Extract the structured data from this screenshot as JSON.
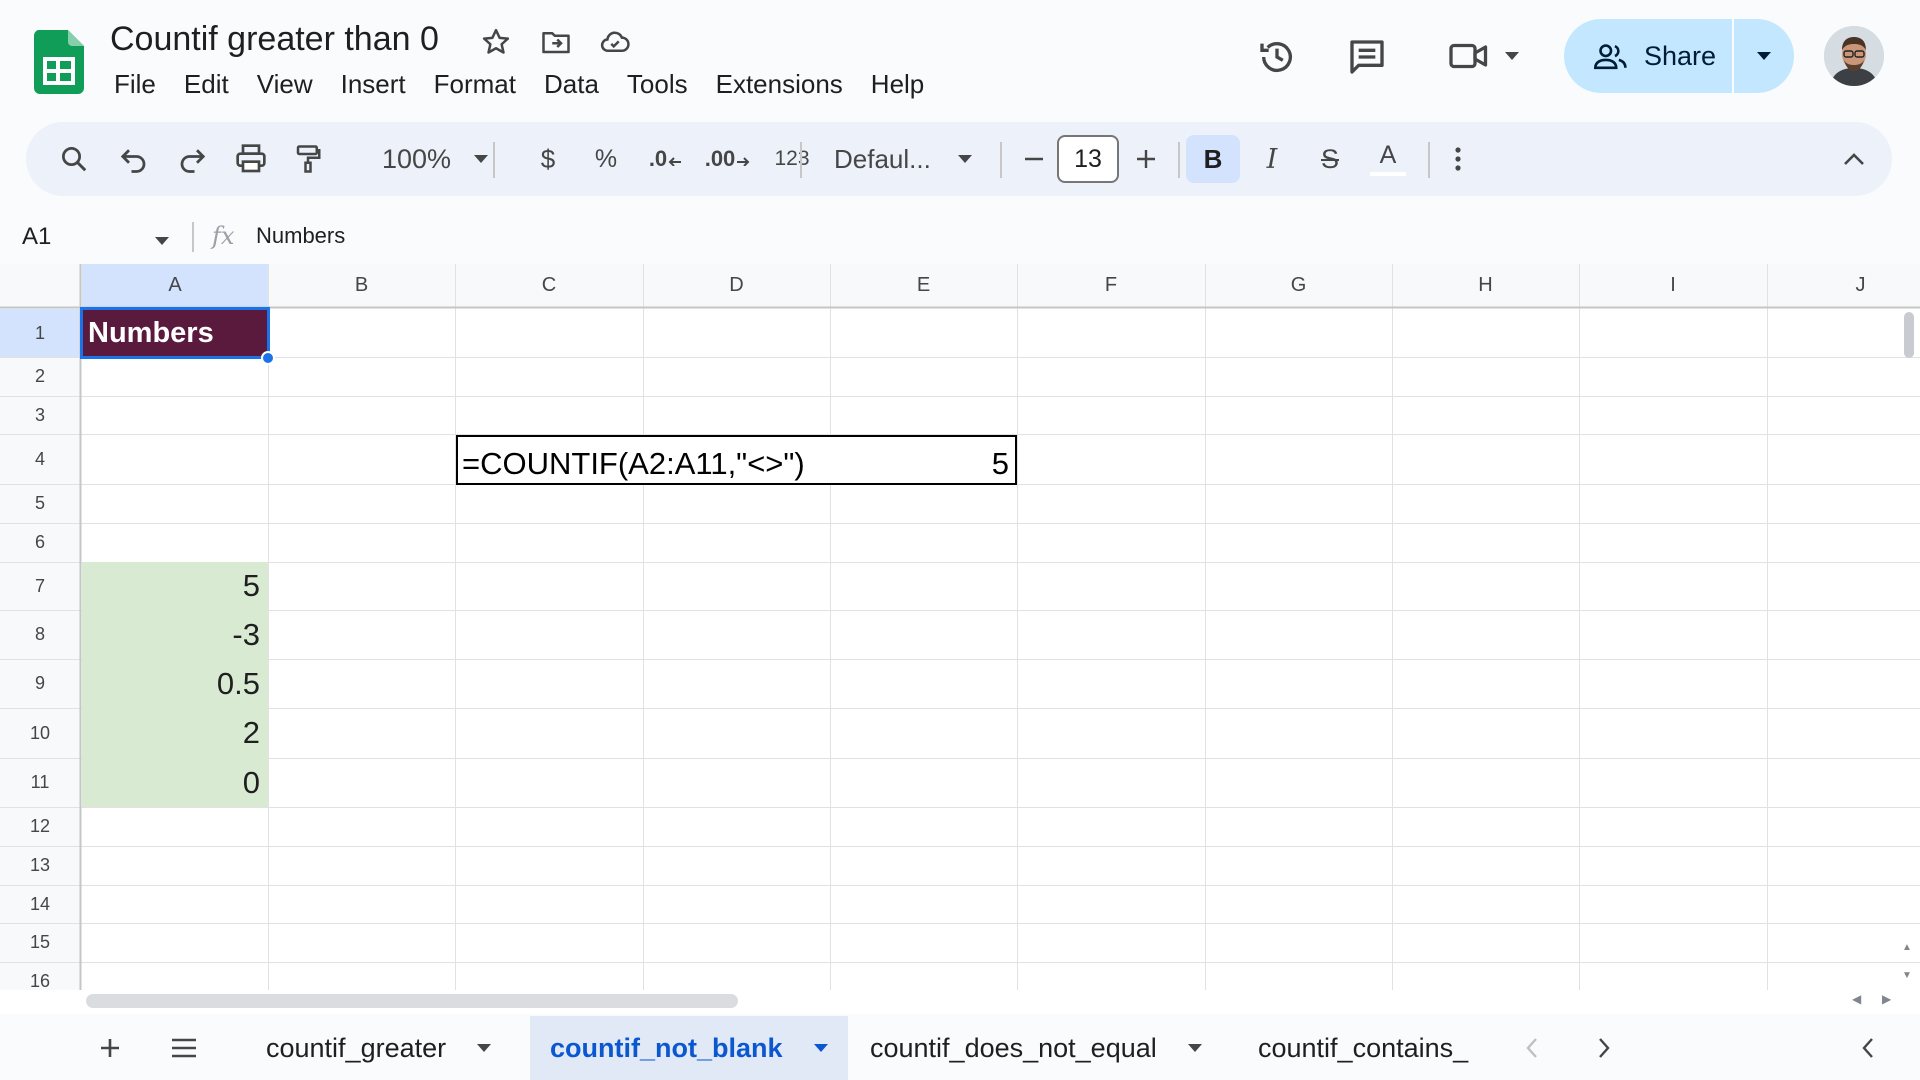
{
  "document": {
    "title": "Countif greater than 0"
  },
  "menu": {
    "items": [
      "File",
      "Edit",
      "View",
      "Insert",
      "Format",
      "Data",
      "Tools",
      "Extensions",
      "Help"
    ]
  },
  "header": {
    "share_label": "Share"
  },
  "toolbar": {
    "zoom": "100%",
    "currency_symbol": "$",
    "percent_symbol": "%",
    "decrease_decimal": ".0",
    "increase_decimal": ".00",
    "number_format": "123",
    "font_family": "Defaul...",
    "font_size": "13",
    "bold_label": "B",
    "italic_label": "I",
    "strike_label": "S",
    "text_color_label": "A"
  },
  "formula_bar": {
    "cell_ref": "A1",
    "fx_label": "fx",
    "content": "Numbers"
  },
  "grid": {
    "columns": [
      "A",
      "B",
      "C",
      "D",
      "E",
      "F",
      "G",
      "H",
      "I",
      "J"
    ],
    "rows": [
      "1",
      "2",
      "3",
      "4",
      "5",
      "6",
      "7",
      "8",
      "9",
      "10",
      "11",
      "12",
      "13",
      "14",
      "15",
      "16"
    ],
    "header_cell": "Numbers",
    "values": [
      "5",
      "-3",
      "0.5",
      "2",
      "0"
    ],
    "formula": "=COUNTIF(A2:A11,\"<>\")",
    "formula_result": "5",
    "header_fill": "#5a1a3e",
    "values_fill": "#d9ead3"
  },
  "sheets": {
    "tabs": [
      "countif_greater",
      "countif_not_blank",
      "countif_does_not_equal",
      "countif_contains_"
    ],
    "active_index": 1
  },
  "colors": {
    "accent": "#1a73e8",
    "share_bg": "#c2e7ff",
    "toolbar_bg": "#edf2fa"
  }
}
